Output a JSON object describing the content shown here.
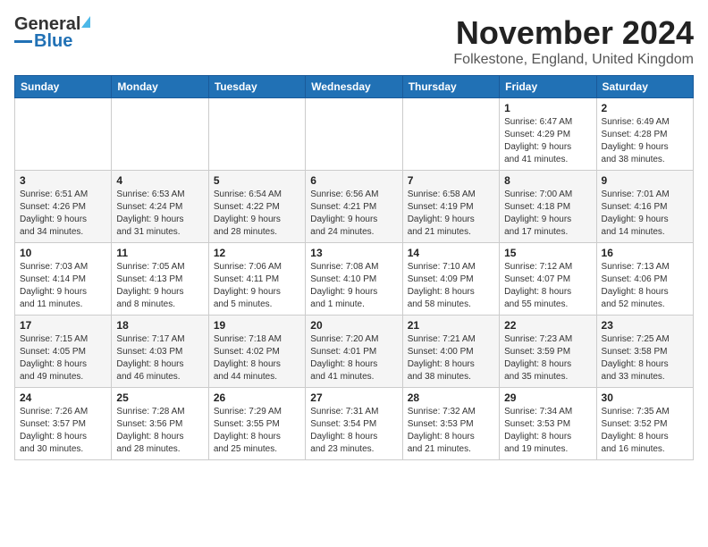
{
  "header": {
    "logo": {
      "general": "General",
      "blue": "Blue"
    },
    "month": "November 2024",
    "location": "Folkestone, England, United Kingdom"
  },
  "weekdays": [
    "Sunday",
    "Monday",
    "Tuesday",
    "Wednesday",
    "Thursday",
    "Friday",
    "Saturday"
  ],
  "weeks": [
    [
      {
        "day": "",
        "info": ""
      },
      {
        "day": "",
        "info": ""
      },
      {
        "day": "",
        "info": ""
      },
      {
        "day": "",
        "info": ""
      },
      {
        "day": "",
        "info": ""
      },
      {
        "day": "1",
        "info": "Sunrise: 6:47 AM\nSunset: 4:29 PM\nDaylight: 9 hours\nand 41 minutes."
      },
      {
        "day": "2",
        "info": "Sunrise: 6:49 AM\nSunset: 4:28 PM\nDaylight: 9 hours\nand 38 minutes."
      }
    ],
    [
      {
        "day": "3",
        "info": "Sunrise: 6:51 AM\nSunset: 4:26 PM\nDaylight: 9 hours\nand 34 minutes."
      },
      {
        "day": "4",
        "info": "Sunrise: 6:53 AM\nSunset: 4:24 PM\nDaylight: 9 hours\nand 31 minutes."
      },
      {
        "day": "5",
        "info": "Sunrise: 6:54 AM\nSunset: 4:22 PM\nDaylight: 9 hours\nand 28 minutes."
      },
      {
        "day": "6",
        "info": "Sunrise: 6:56 AM\nSunset: 4:21 PM\nDaylight: 9 hours\nand 24 minutes."
      },
      {
        "day": "7",
        "info": "Sunrise: 6:58 AM\nSunset: 4:19 PM\nDaylight: 9 hours\nand 21 minutes."
      },
      {
        "day": "8",
        "info": "Sunrise: 7:00 AM\nSunset: 4:18 PM\nDaylight: 9 hours\nand 17 minutes."
      },
      {
        "day": "9",
        "info": "Sunrise: 7:01 AM\nSunset: 4:16 PM\nDaylight: 9 hours\nand 14 minutes."
      }
    ],
    [
      {
        "day": "10",
        "info": "Sunrise: 7:03 AM\nSunset: 4:14 PM\nDaylight: 9 hours\nand 11 minutes."
      },
      {
        "day": "11",
        "info": "Sunrise: 7:05 AM\nSunset: 4:13 PM\nDaylight: 9 hours\nand 8 minutes."
      },
      {
        "day": "12",
        "info": "Sunrise: 7:06 AM\nSunset: 4:11 PM\nDaylight: 9 hours\nand 5 minutes."
      },
      {
        "day": "13",
        "info": "Sunrise: 7:08 AM\nSunset: 4:10 PM\nDaylight: 9 hours\nand 1 minute."
      },
      {
        "day": "14",
        "info": "Sunrise: 7:10 AM\nSunset: 4:09 PM\nDaylight: 8 hours\nand 58 minutes."
      },
      {
        "day": "15",
        "info": "Sunrise: 7:12 AM\nSunset: 4:07 PM\nDaylight: 8 hours\nand 55 minutes."
      },
      {
        "day": "16",
        "info": "Sunrise: 7:13 AM\nSunset: 4:06 PM\nDaylight: 8 hours\nand 52 minutes."
      }
    ],
    [
      {
        "day": "17",
        "info": "Sunrise: 7:15 AM\nSunset: 4:05 PM\nDaylight: 8 hours\nand 49 minutes."
      },
      {
        "day": "18",
        "info": "Sunrise: 7:17 AM\nSunset: 4:03 PM\nDaylight: 8 hours\nand 46 minutes."
      },
      {
        "day": "19",
        "info": "Sunrise: 7:18 AM\nSunset: 4:02 PM\nDaylight: 8 hours\nand 44 minutes."
      },
      {
        "day": "20",
        "info": "Sunrise: 7:20 AM\nSunset: 4:01 PM\nDaylight: 8 hours\nand 41 minutes."
      },
      {
        "day": "21",
        "info": "Sunrise: 7:21 AM\nSunset: 4:00 PM\nDaylight: 8 hours\nand 38 minutes."
      },
      {
        "day": "22",
        "info": "Sunrise: 7:23 AM\nSunset: 3:59 PM\nDaylight: 8 hours\nand 35 minutes."
      },
      {
        "day": "23",
        "info": "Sunrise: 7:25 AM\nSunset: 3:58 PM\nDaylight: 8 hours\nand 33 minutes."
      }
    ],
    [
      {
        "day": "24",
        "info": "Sunrise: 7:26 AM\nSunset: 3:57 PM\nDaylight: 8 hours\nand 30 minutes."
      },
      {
        "day": "25",
        "info": "Sunrise: 7:28 AM\nSunset: 3:56 PM\nDaylight: 8 hours\nand 28 minutes."
      },
      {
        "day": "26",
        "info": "Sunrise: 7:29 AM\nSunset: 3:55 PM\nDaylight: 8 hours\nand 25 minutes."
      },
      {
        "day": "27",
        "info": "Sunrise: 7:31 AM\nSunset: 3:54 PM\nDaylight: 8 hours\nand 23 minutes."
      },
      {
        "day": "28",
        "info": "Sunrise: 7:32 AM\nSunset: 3:53 PM\nDaylight: 8 hours\nand 21 minutes."
      },
      {
        "day": "29",
        "info": "Sunrise: 7:34 AM\nSunset: 3:53 PM\nDaylight: 8 hours\nand 19 minutes."
      },
      {
        "day": "30",
        "info": "Sunrise: 7:35 AM\nSunset: 3:52 PM\nDaylight: 8 hours\nand 16 minutes."
      }
    ]
  ]
}
